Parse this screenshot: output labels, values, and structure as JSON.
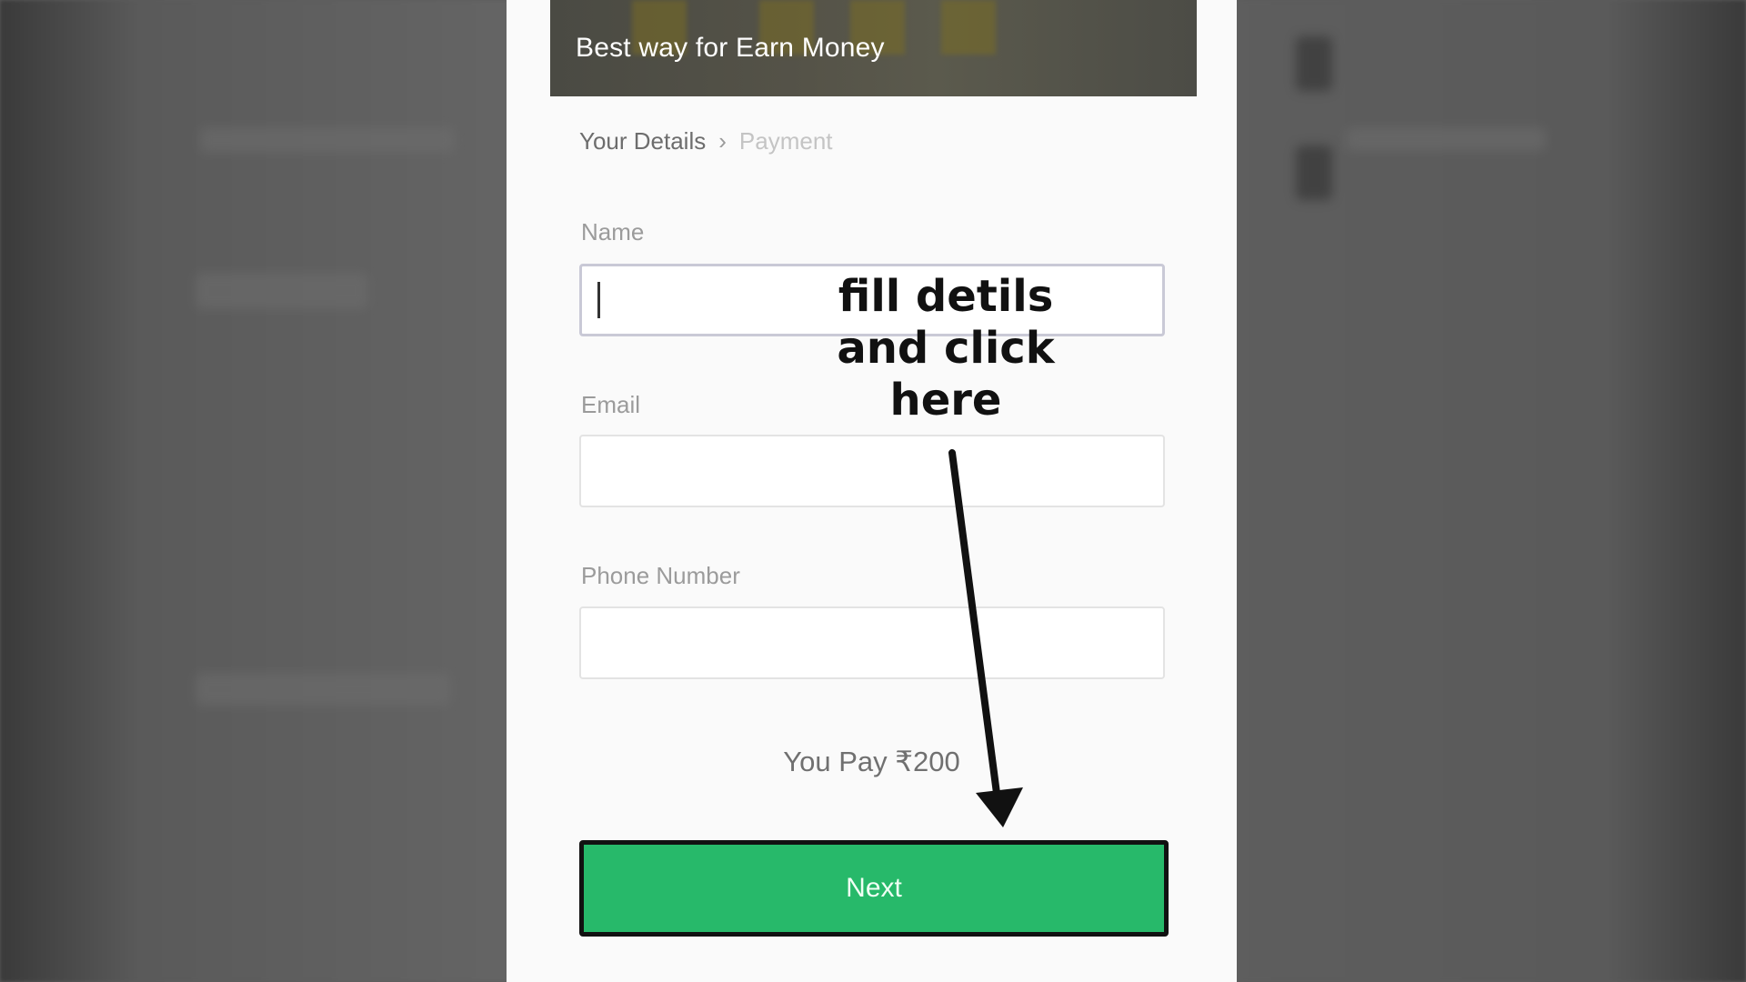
{
  "banner": {
    "title": "Best way for Earn Money"
  },
  "steps": {
    "active": "Your Details",
    "inactive": "Payment"
  },
  "form": {
    "name_label": "Name",
    "email_label": "Email",
    "phone_label": "Phone Number",
    "name_value": "",
    "email_value": "",
    "phone_value": ""
  },
  "payment": {
    "amount_text": "You Pay ₹200"
  },
  "next_button": {
    "label": "Next"
  },
  "annotation": {
    "line1": "fill detils",
    "line2": "and click",
    "line3": "here"
  },
  "colors": {
    "accent": "#27b96a",
    "banner": "#4f4e46",
    "background": "#5c5c5c"
  },
  "icons": {
    "step_separator": "chevron-right-icon",
    "annotation_arrow": "arrow-down-icon"
  }
}
